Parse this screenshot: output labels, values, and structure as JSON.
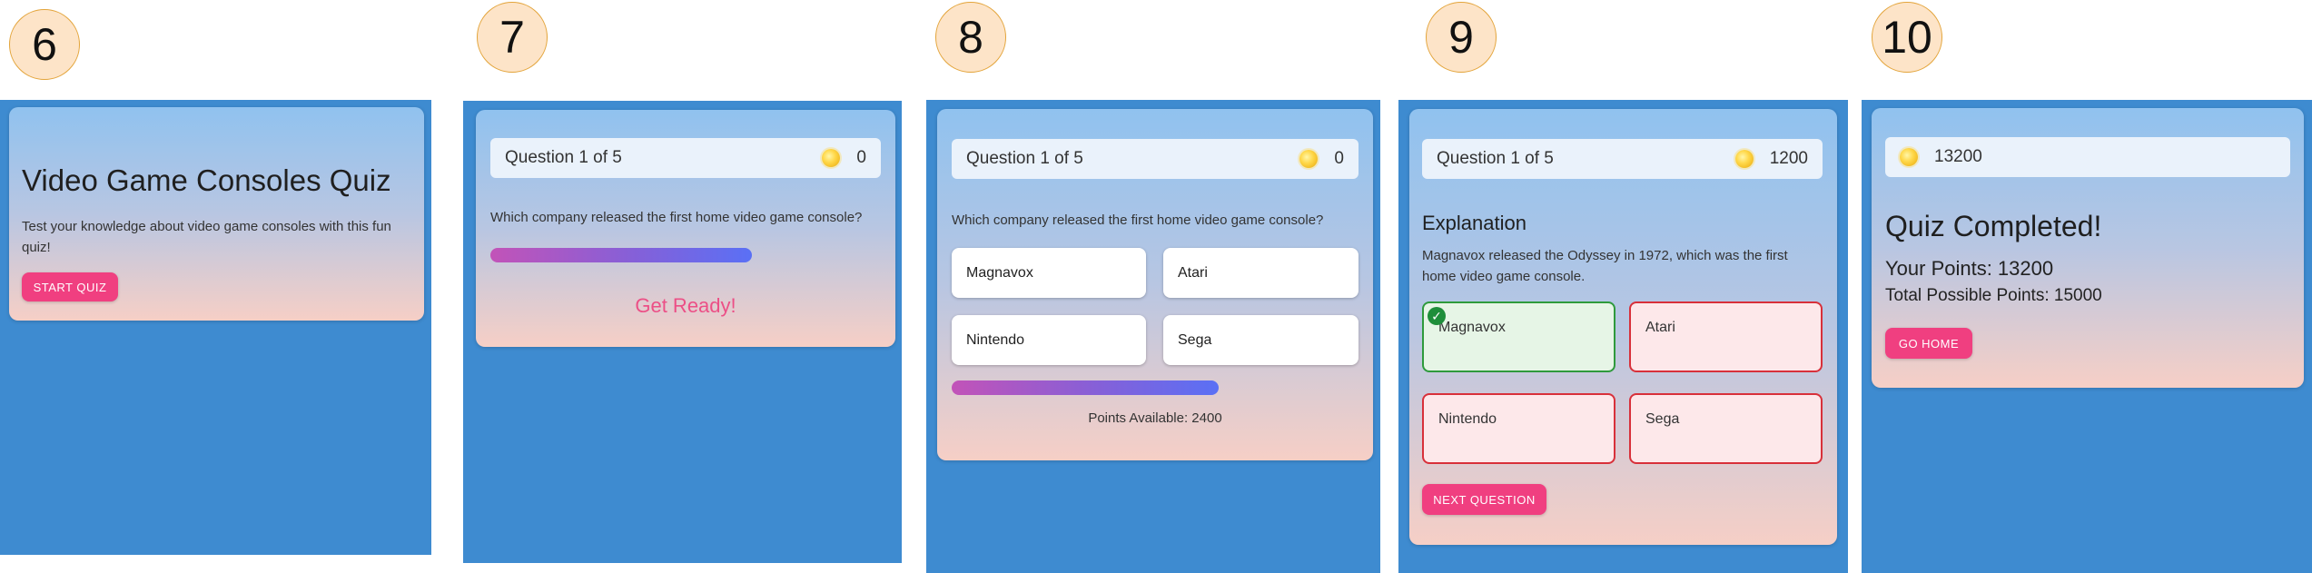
{
  "steps": [
    {
      "number": "6"
    },
    {
      "number": "7"
    },
    {
      "number": "8"
    },
    {
      "number": "9"
    },
    {
      "number": "10"
    }
  ],
  "screen6": {
    "title": "Video Game Consoles Quiz",
    "description": "Test your knowledge about video game consoles with this fun quiz!",
    "start_button": "START QUIZ"
  },
  "screen7": {
    "question_counter": "Question 1 of 5",
    "points": "0",
    "question": "Which company released the first home video game console?",
    "progress": 0.7,
    "status": "Get Ready!"
  },
  "screen8": {
    "question_counter": "Question 1 of 5",
    "points": "0",
    "question": "Which company released the first home video game console?",
    "options": [
      "Magnavox",
      "Atari",
      "Nintendo",
      "Sega"
    ],
    "progress": 0.7,
    "points_available": "Points Available: 2400"
  },
  "screen9": {
    "question_counter": "Question 1 of 5",
    "points": "1200",
    "explanation_title": "Explanation",
    "explanation_text": "Magnavox released the Odyssey in 1972, which was the first home video game console.",
    "options": [
      "Magnavox",
      "Atari",
      "Nintendo",
      "Sega"
    ],
    "correct_option": "Magnavox",
    "next_button": "NEXT QUESTION"
  },
  "screen10": {
    "points": "13200",
    "title": "Quiz Completed!",
    "your_points": "Your Points: 13200",
    "total_possible": "Total Possible Points: 15000",
    "home_button": "GO HOME"
  },
  "colors": {
    "panel_background": "#3e8bd0",
    "accent_pink": "#f03f80",
    "correct_green": "#2e9a3c",
    "wrong_red": "#d8303a",
    "get_ready_text": "#ec4f86"
  },
  "icons": [
    "coin-icon",
    "checkmark-icon"
  ]
}
